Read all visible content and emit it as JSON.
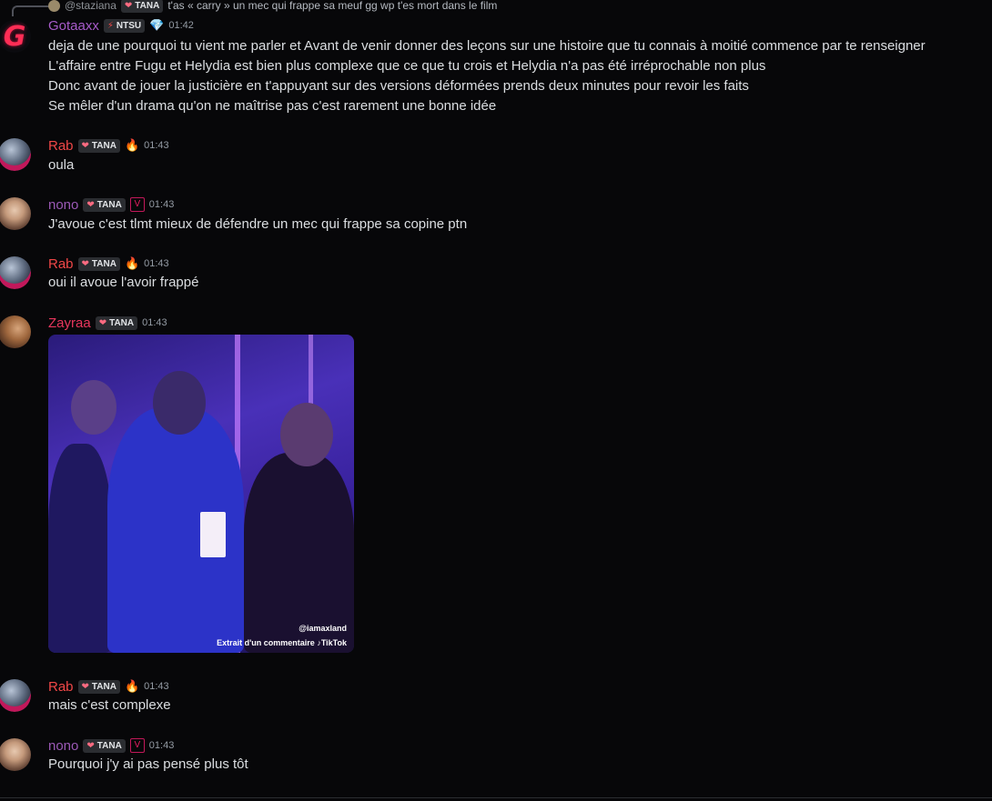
{
  "reply": {
    "username": "@staziana",
    "badge": "TANA",
    "text": "t'as « carry » un mec qui frappe sa meuf gg wp t'es mort dans le film"
  },
  "messages": [
    {
      "username": "Gotaaxx",
      "username_color": "#a75bc9",
      "avatar_glyph": "G",
      "badge": "NTSU",
      "badge_icon": "bolt-icon",
      "role_icon": "gem-icon",
      "time": "01:42",
      "lines": [
        "deja de une pourquoi tu vient me parler et Avant de venir donner des leçons sur une histoire que tu connais à moitié commence par te renseigner",
        "L'affaire entre Fugu et Helydia est bien plus complexe que ce que tu crois et Helydia n'a pas été irréprochable non plus",
        "Donc avant de jouer la justicière en t'appuyant sur des versions déformées prends deux minutes pour revoir les faits",
        "Se mêler d'un drama qu'on ne maîtrise pas c'est rarement une bonne idée"
      ]
    },
    {
      "username": "Rab",
      "username_color": "#f04747",
      "badge": "TANA",
      "role_icon": "flame-icon",
      "time": "01:43",
      "text": "oula"
    },
    {
      "username": "nono",
      "username_color": "#9b59b6",
      "badge": "TANA",
      "role_icon": "valorant-icon",
      "time": "01:43",
      "text": "J'avoue c'est tlmt mieux de défendre un mec qui frappe sa copine ptn"
    },
    {
      "username": "Rab",
      "username_color": "#f04747",
      "badge": "TANA",
      "role_icon": "flame-icon",
      "time": "01:43",
      "text": "oui il avoue l'avoir frappé"
    },
    {
      "username": "Zayraa",
      "username_color": "#e8365d",
      "badge": "TANA",
      "time": "01:43",
      "media": {
        "handle": "@iamaxland",
        "caption": "Extrait d'un commentaire",
        "brand": "TikTok"
      }
    },
    {
      "username": "Rab",
      "username_color": "#f04747",
      "badge": "TANA",
      "role_icon": "flame-icon",
      "time": "01:43",
      "text": "mais c'est complexe"
    },
    {
      "username": "nono",
      "username_color": "#9b59b6",
      "badge": "TANA",
      "role_icon": "valorant-icon",
      "time": "01:43",
      "text": "Pourquoi j'y ai pas pensé plus tôt"
    }
  ]
}
